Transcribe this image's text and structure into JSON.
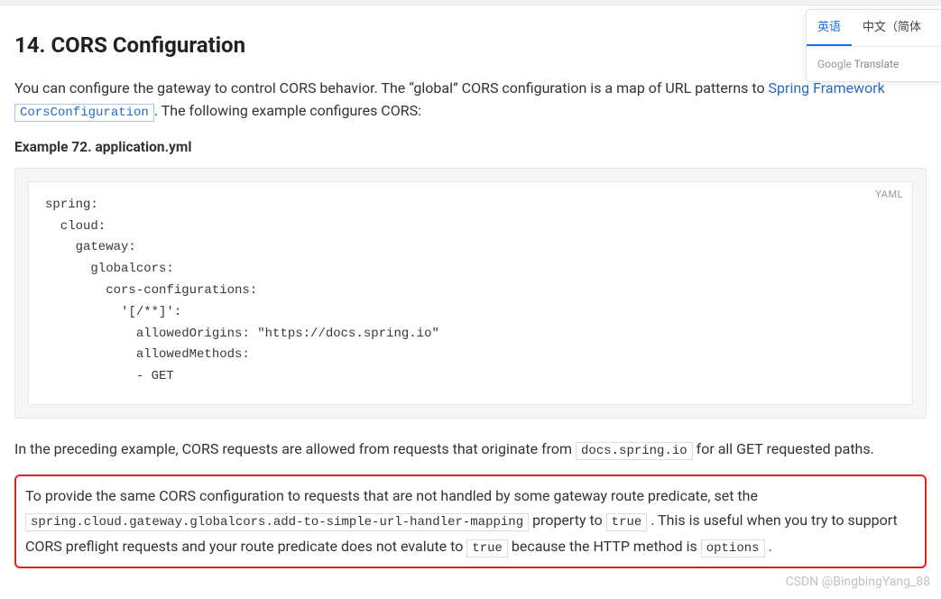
{
  "header": {
    "title": "14. CORS Configuration"
  },
  "intro": {
    "text_before_link": "You can configure the gateway to control CORS behavior. The “global” CORS configuration is a map of URL patterns to ",
    "link_text": "Spring\nFramework ",
    "code_link": "CorsConfiguration",
    "text_after": ". The following example configures CORS:"
  },
  "example": {
    "label": "Example 72. application.yml",
    "lang": "YAML",
    "code": "spring:\n  cloud:\n    gateway:\n      globalcors:\n        cors-configurations:\n          '[/**]':\n            allowedOrigins: \"https://docs.spring.io\"\n            allowedMethods:\n            - GET"
  },
  "followup": {
    "before": "In the preceding example, CORS requests are allowed from requests that originate from ",
    "code1": "docs.spring.io",
    "after1": " for all GET requested paths."
  },
  "note": {
    "t1": "To provide the same CORS configuration to requests that are not handled by some gateway route predicate, set the ",
    "code1": "spring.cloud.gateway.globalcors.add-to-simple-url-handler-mapping",
    "t2": " property to ",
    "code2": "true",
    "t3": ". This is useful when you try to support CORS preflight requests and your route predicate does not evalute to ",
    "code3": "true",
    "t4": " because the HTTP method is ",
    "code4": "options",
    "t5": "."
  },
  "translate": {
    "tab_active": "英语",
    "tab_other": "中文（简体",
    "brand_left": "Google",
    "brand_right": " Translate"
  },
  "watermark": "CSDN @BingbingYang_88"
}
